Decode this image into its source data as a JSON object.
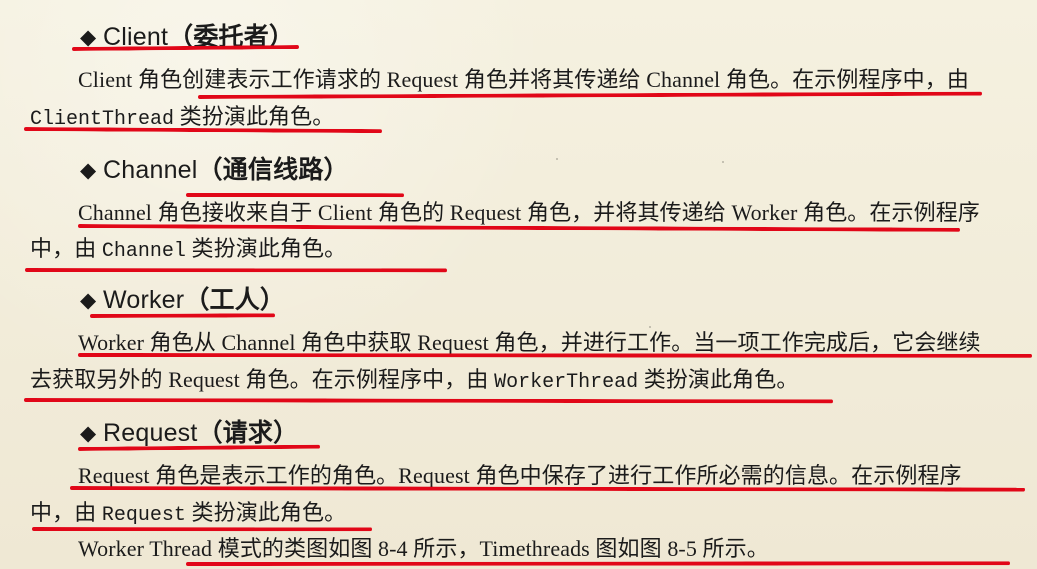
{
  "sections": [
    {
      "symbol": "◆",
      "name": "Client",
      "paren_text": "（委托者）",
      "paragraph": {
        "line1": "Client 角色创建表示工作请求的 Request 角色并将其传递给 Channel 角色。在示例程序中，由",
        "line2_code": "ClientThread",
        "line2_tail": "类扮演此角色。"
      }
    },
    {
      "symbol": "◆",
      "name": "Channel",
      "paren_text": "（通信线路）",
      "paragraph": {
        "line1": "Channel 角色接收来自于 Client 角色的 Request 角色，并将其传递给 Worker 角色。在示例程序",
        "line2_prefix": "中，由",
        "line2_code": "Channel",
        "line2_tail": "类扮演此角色。"
      }
    },
    {
      "symbol": "◆",
      "name": "Worker",
      "paren_text": "（工人）",
      "paragraph": {
        "line1": "Worker 角色从 Channel 角色中获取 Request 角色，并进行工作。当一项工作完成后，它会继续",
        "line2_prefix": "去获取另外的 Request 角色。在示例程序中，由",
        "line2_code": "WorkerThread",
        "line2_tail": "类扮演此角色。"
      }
    },
    {
      "symbol": "◆",
      "name": "Request",
      "paren_text": "（请求）",
      "paragraph": {
        "line1": "Request 角色是表示工作的角色。Request 角色中保存了进行工作所必需的信息。在示例程序",
        "line2_prefix": "中，由",
        "line2_code": "Request",
        "line2_tail": "类扮演此角色。"
      }
    }
  ],
  "footer_line": "Worker Thread 模式的类图如图 8-4 所示，Timethreads 图如图 8-5 所示。",
  "highlight_color": "#e10718"
}
